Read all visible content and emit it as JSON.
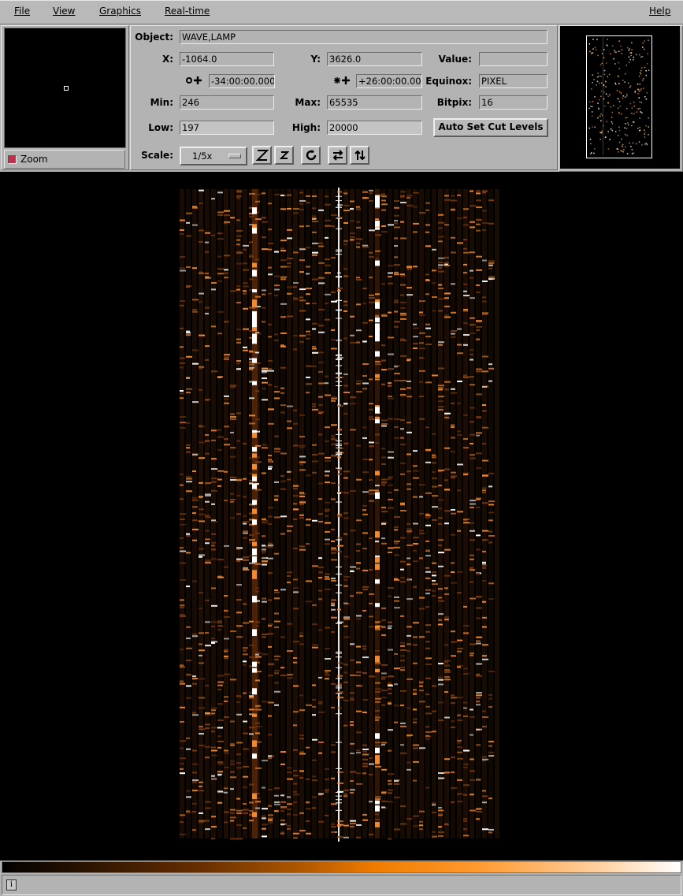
{
  "menu": {
    "file": "File",
    "view": "View",
    "graphics": "Graphics",
    "realtime": "Real-time",
    "help": "Help"
  },
  "zoom": {
    "label": "Zoom"
  },
  "info": {
    "object_label": "Object:",
    "object_value": "WAVE,LAMP",
    "x_label": "X:",
    "x_value": "-1064.0",
    "y_label": "Y:",
    "y_value": "3626.0",
    "value_label": "Value:",
    "value_value": "",
    "ra_value": "-34:00:00.000",
    "dec_value": "+26:00:00.00",
    "equinox_label": "Equinox:",
    "equinox_value": "PIXEL",
    "min_label": "Min:",
    "min_value": "246",
    "max_label": "Max:",
    "max_value": "65535",
    "bitpix_label": "Bitpix:",
    "bitpix_value": "16",
    "low_label": "Low:",
    "low_value": "197",
    "high_label": "High:",
    "high_value": "20000",
    "auto_cut_label": "Auto Set Cut Levels",
    "scale_label": "Scale:",
    "scale_value": "1/5x"
  },
  "icons": {
    "zoom_out": "zoom-out-icon",
    "zoom_in": "zoom-in-icon",
    "rotate": "rotate-icon",
    "flip_x": "flip-x-icon",
    "flip_y": "flip-y-icon",
    "ra": "ra-compass-icon",
    "dec": "dec-compass-icon",
    "info": "info-icon"
  },
  "colors": {
    "bright": "#ffffff",
    "orange": "#f08a30",
    "dim": "#7a3c10"
  }
}
